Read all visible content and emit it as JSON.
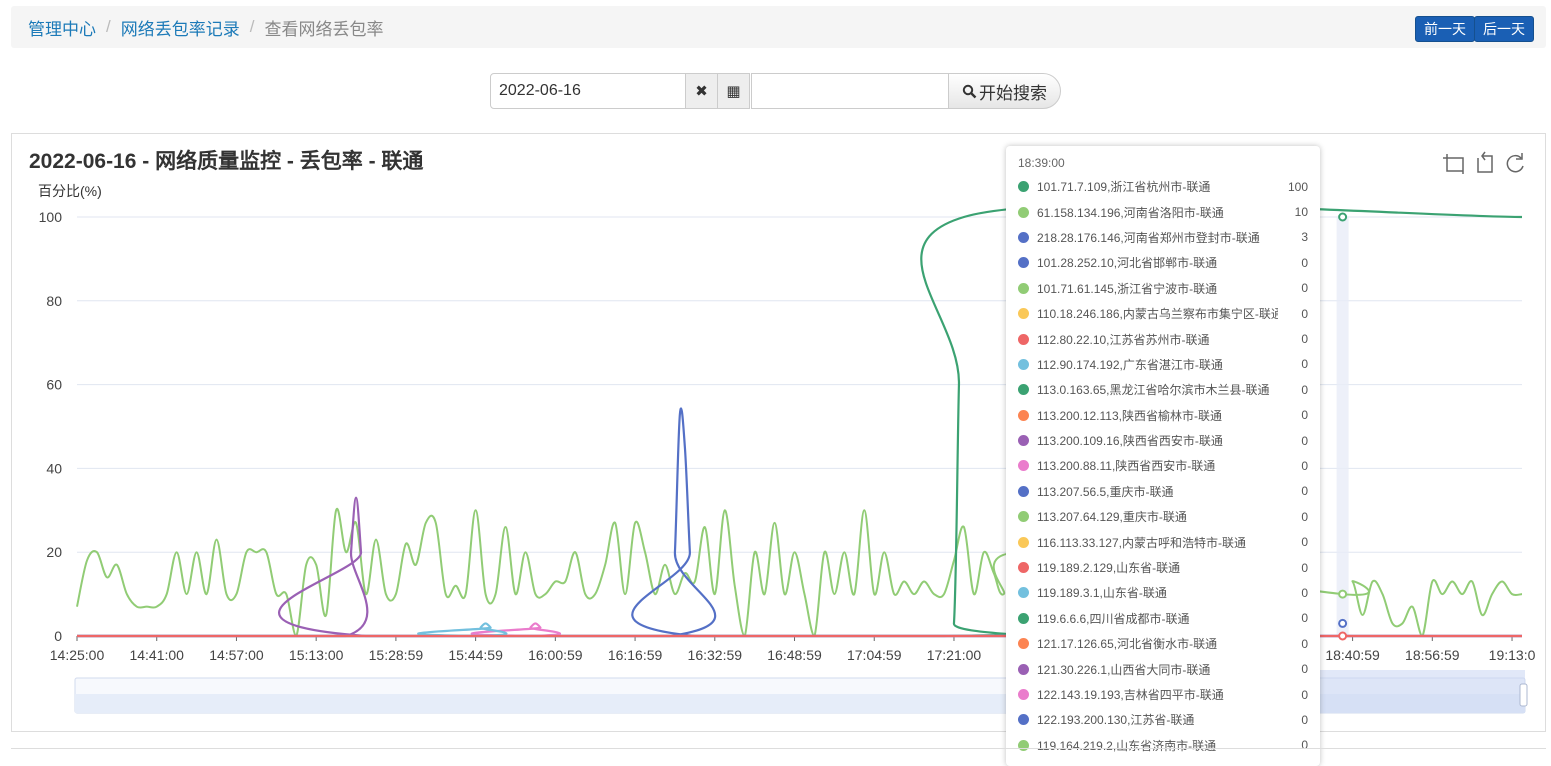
{
  "breadcrumb": {
    "home": "管理中心",
    "records": "网络丢包率记录",
    "current": "查看网络丢包率",
    "separator": "/"
  },
  "nav_buttons": {
    "prev": "前一天",
    "next": "后一天"
  },
  "search": {
    "date_value": "2022-06-16",
    "text_value": "",
    "clear_icon": "✖",
    "calendar_icon": "▦",
    "button_label": "开始搜索",
    "button_icon": "search-icon"
  },
  "toolbox": [
    "zoom-icon",
    "zoom-reset-icon",
    "restore-icon"
  ],
  "colors": {
    "series_green": "#3ba272",
    "series_lightgreen": "#91cc75",
    "series_blue": "#5470c6",
    "series_purple": "#9a60b4",
    "series_pink": "#ea7ccc",
    "series_cyan": "#73c0de",
    "series_red": "#ee6666",
    "series_yellow": "#fac858",
    "series_orange": "#fc8452",
    "link": "#1c7ab8",
    "button": "#1a5fb4"
  },
  "chart_data": {
    "type": "line",
    "title": "2022-06-16 - 网络质量监控 - 丢包率 - 联通",
    "ylabel": "百分比(%)",
    "ylim": [
      0,
      100
    ],
    "yticks": [
      0,
      20,
      40,
      60,
      80,
      100
    ],
    "xtick_labels": [
      "14:25:00",
      "14:41:00",
      "14:57:00",
      "15:13:00",
      "15:28:59",
      "15:44:59",
      "16:00:59",
      "16:16:59",
      "16:32:59",
      "16:48:59",
      "17:04:59",
      "17:21:00",
      "18:40:59",
      "18:56:59",
      "19:13:0"
    ],
    "xtick_positions_min": [
      0,
      16,
      32,
      48,
      64,
      80,
      96,
      112,
      128,
      144,
      160,
      176,
      256,
      272,
      288
    ],
    "x_unit": "minutes after 14:25:00",
    "x_range": [
      0,
      290
    ],
    "hover_x": 254,
    "series": [
      {
        "name": "61.158.134.196,河南省洛阳市-联通",
        "color": "#91cc75",
        "x": [
          0,
          2,
          4,
          6,
          8,
          10,
          12,
          14,
          16,
          18,
          20,
          22,
          24,
          26,
          28,
          30,
          32,
          34,
          36,
          38,
          40,
          42,
          44,
          46,
          48,
          50,
          52,
          54,
          56,
          58,
          60,
          62,
          64,
          66,
          68,
          70,
          72,
          74,
          76,
          78,
          80,
          82,
          84,
          86,
          88,
          90,
          92,
          94,
          96,
          98,
          100,
          102,
          104,
          106,
          108,
          110,
          112,
          114,
          116,
          118,
          120,
          122,
          124,
          126,
          128,
          130,
          132,
          134,
          136,
          138,
          140,
          142,
          144,
          146,
          148,
          150,
          152,
          154,
          156,
          158,
          160,
          162,
          164,
          166,
          168,
          170,
          172,
          174,
          176,
          178,
          180,
          182,
          184,
          186,
          190,
          254,
          256,
          258,
          260,
          262,
          264,
          266,
          268,
          270,
          272,
          274,
          276,
          278,
          280,
          282,
          284,
          286,
          288,
          290
        ],
        "values": [
          7,
          18,
          20,
          14,
          17,
          10,
          7,
          7,
          7,
          10,
          20,
          10,
          20,
          10,
          23,
          10,
          10,
          20,
          20,
          20,
          10,
          10,
          0,
          17,
          17,
          5,
          30,
          20,
          27,
          10,
          23,
          10,
          10,
          22,
          17,
          27,
          27,
          10,
          12,
          10,
          30,
          10,
          10,
          26,
          10,
          20,
          10,
          10,
          13,
          13,
          20,
          10,
          10,
          17,
          27,
          10,
          27,
          20,
          10,
          17,
          10,
          15,
          13,
          26,
          10,
          30,
          12,
          0,
          20,
          10,
          27,
          10,
          20,
          10,
          0,
          20,
          10,
          20,
          10,
          30,
          10,
          20,
          10,
          13,
          10,
          13,
          10,
          10,
          18,
          26,
          10,
          20,
          15,
          10,
          20,
          10,
          13,
          5,
          13,
          10,
          3,
          3,
          7,
          0,
          13,
          10,
          13,
          10,
          13,
          5,
          10,
          13,
          10,
          10
        ]
      },
      {
        "name": "101.71.7.109,浙江省杭州市-联通",
        "color": "#3ba272",
        "x": [
          0,
          174,
          176,
          177,
          178,
          290
        ],
        "values": [
          0,
          0,
          3,
          60,
          100,
          100
        ]
      },
      {
        "name": "218.28.176.146,河南省郑州市登封市-联通",
        "color": "#5470c6",
        "x": [
          0,
          119,
          120,
          121,
          122,
          123,
          124,
          290
        ],
        "values": [
          0,
          0,
          20,
          53,
          45,
          20,
          0,
          0
        ]
      },
      {
        "name": "113.200.109.16,陕西省西安市-联通",
        "color": "#9a60b4",
        "x": [
          0,
          54,
          55,
          56,
          57,
          58,
          290
        ],
        "values": [
          0,
          0,
          20,
          33,
          20,
          0,
          0
        ]
      },
      {
        "name": "122.143.19.193,吉林省四平市-联通",
        "color": "#ea7ccc",
        "x": [
          0,
          90,
          91,
          92,
          93,
          94,
          290
        ],
        "values": [
          0,
          0,
          2,
          3,
          2,
          0,
          0
        ]
      },
      {
        "name": "112.90.174.192,广东省湛江市-联通",
        "color": "#73c0de",
        "x": [
          0,
          80,
          81,
          82,
          83,
          84,
          290
        ],
        "values": [
          0,
          0,
          2,
          3,
          2,
          0,
          0
        ]
      },
      {
        "name": "112.80.22.10,江苏省苏州市-联通",
        "color": "#ee6666",
        "x": [
          0,
          290
        ],
        "values": [
          0,
          0
        ]
      }
    ],
    "tooltip": {
      "time": "18:39:00",
      "rows": [
        {
          "name": "101.71.7.109,浙江省杭州市-联通",
          "value": "100",
          "color": "#3ba272"
        },
        {
          "name": "61.158.134.196,河南省洛阳市-联通",
          "value": "10",
          "color": "#91cc75"
        },
        {
          "name": "218.28.176.146,河南省郑州市登封市-联通",
          "value": "3",
          "color": "#5470c6"
        },
        {
          "name": "101.28.252.10,河北省邯郸市-联通",
          "value": "0",
          "color": "#5470c6"
        },
        {
          "name": "101.71.61.145,浙江省宁波市-联通",
          "value": "0",
          "color": "#91cc75"
        },
        {
          "name": "110.18.246.186,内蒙古乌兰察布市集宁区-联通",
          "value": "0",
          "color": "#fac858"
        },
        {
          "name": "112.80.22.10,江苏省苏州市-联通",
          "value": "0",
          "color": "#ee6666"
        },
        {
          "name": "112.90.174.192,广东省湛江市-联通",
          "value": "0",
          "color": "#73c0de"
        },
        {
          "name": "113.0.163.65,黑龙江省哈尔滨市木兰县-联通",
          "value": "0",
          "color": "#3ba272"
        },
        {
          "name": "113.200.12.113,陕西省榆林市-联通",
          "value": "0",
          "color": "#fc8452"
        },
        {
          "name": "113.200.109.16,陕西省西安市-联通",
          "value": "0",
          "color": "#9a60b4"
        },
        {
          "name": "113.200.88.11,陕西省西安市-联通",
          "value": "0",
          "color": "#ea7ccc"
        },
        {
          "name": "113.207.56.5,重庆市-联通",
          "value": "0",
          "color": "#5470c6"
        },
        {
          "name": "113.207.64.129,重庆市-联通",
          "value": "0",
          "color": "#91cc75"
        },
        {
          "name": "116.113.33.127,内蒙古呼和浩特市-联通",
          "value": "0",
          "color": "#fac858"
        },
        {
          "name": "119.189.2.129,山东省-联通",
          "value": "0",
          "color": "#ee6666"
        },
        {
          "name": "119.189.3.1,山东省-联通",
          "value": "0",
          "color": "#73c0de"
        },
        {
          "name": "119.6.6.6,四川省成都市-联通",
          "value": "0",
          "color": "#3ba272"
        },
        {
          "name": "121.17.126.65,河北省衡水市-联通",
          "value": "0",
          "color": "#fc8452"
        },
        {
          "name": "121.30.226.1,山西省大同市-联通",
          "value": "0",
          "color": "#9a60b4"
        },
        {
          "name": "122.143.19.193,吉林省四平市-联通",
          "value": "0",
          "color": "#ea7ccc"
        },
        {
          "name": "122.193.200.130,江苏省-联通",
          "value": "0",
          "color": "#5470c6"
        },
        {
          "name": "119.164.219.2,山东省济南市-联通",
          "value": "0",
          "color": "#91cc75"
        }
      ]
    }
  }
}
